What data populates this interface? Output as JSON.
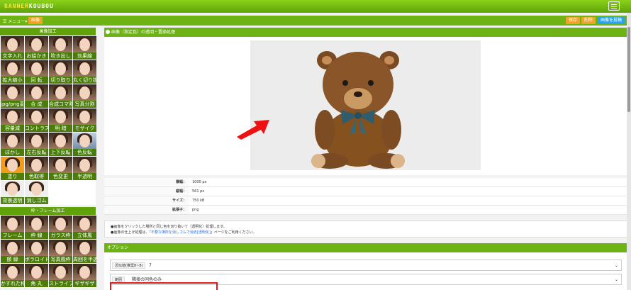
{
  "app": {
    "logo_part1": "BANNER",
    "logo_part2": "KOUBOU"
  },
  "subbar": {
    "menu_label": "メニュー",
    "tag_left": "画像",
    "btn1": "保存",
    "btn2": "削除",
    "btn3": "画像を投稿"
  },
  "sidebar": {
    "section1_title": "画像加工",
    "tiles1": [
      "文字入れ",
      "お絵かき",
      "吹き出し",
      "効果線",
      "拡大縮小",
      "回 転",
      "切り取り",
      "丸く切り抜き",
      "jpg/png変換",
      "合 成",
      "合成コマ割",
      "写真分割",
      "容量減",
      "コントラスト",
      "明 暗",
      "モザイク",
      "ぼかし",
      "左右反転",
      "上下反転",
      "色反転",
      "塗り",
      "色取得",
      "色変更",
      "半透明",
      "背景透明",
      "消しゴム"
    ],
    "section2_title": "枠・フレーム加工",
    "tiles2": [
      "フレーム",
      "枠 線",
      "ガラス枠",
      "立体風",
      "額 縁",
      "ポラロイド",
      "写真風枠",
      "周囲を半透明",
      "かすれた枠",
      "角 丸",
      "ストライプ枠",
      "ギザギザ"
    ]
  },
  "main": {
    "panel_title": "画像（指定色）の透明・置換処理",
    "info": [
      {
        "k": "横幅：",
        "v": "1000 px"
      },
      {
        "k": "縦幅：",
        "v": "561 px"
      },
      {
        "k": "サイズ：",
        "v": "750 kB"
      },
      {
        "k": "拡張子：",
        "v": "png"
      }
    ],
    "notes_line1": "●画像をクリックした場所と同じ色を切り抜いて（透明化）処理します。",
    "notes_line2_pre": "●画像の仕上げ処理は、「",
    "notes_line2_link": "不要な場所を消しゴムで消去[透明化]",
    "notes_line2_post": "」ページをご利用ください。",
    "options_title": "オプション",
    "field1_prefix": "近似値(推奨8~8)",
    "field1_value": "7",
    "field2_prefix": "範囲",
    "field2_value": "隣接の同色のみ"
  }
}
